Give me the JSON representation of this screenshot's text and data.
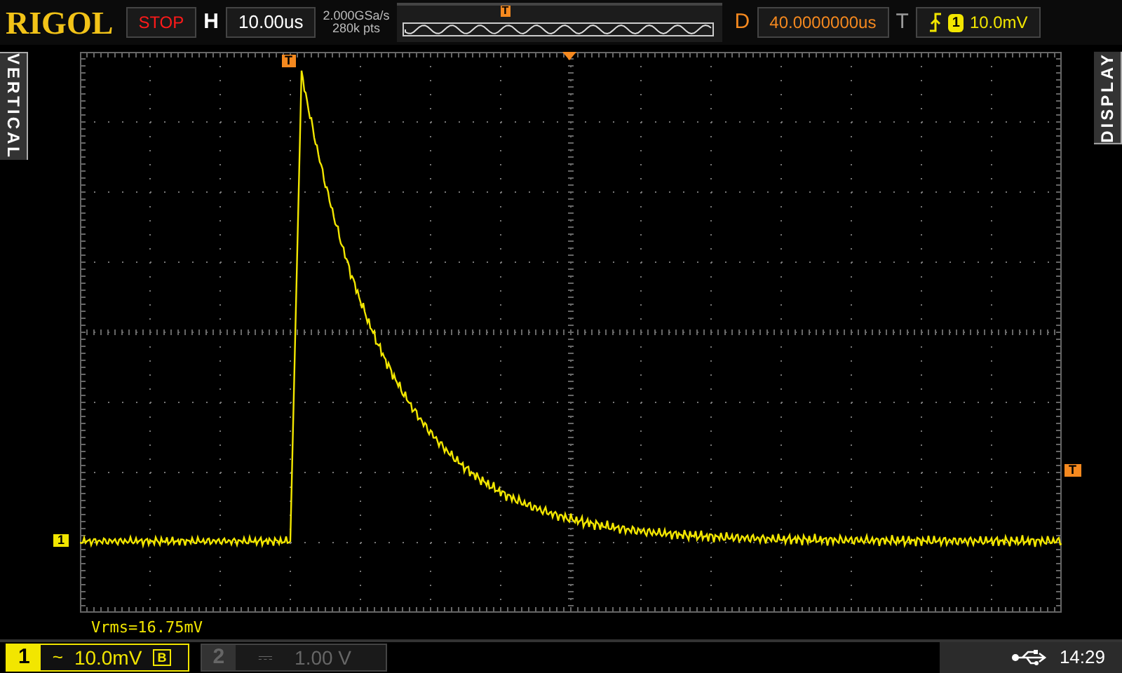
{
  "brand": "RIGOL",
  "run_state": "STOP",
  "horizontal": {
    "label": "H",
    "timebase": "10.00us"
  },
  "acquisition": {
    "sample_rate": "2.000GSa/s",
    "memory_depth": "280k pts"
  },
  "delay": {
    "label": "D",
    "value": "40.0000000us"
  },
  "trigger": {
    "label": "T",
    "channel": "1",
    "level": "10.0mV"
  },
  "side_tabs": [
    {
      "label": "VERTICAL",
      "kind": "left"
    },
    {
      "label": "DISPLAY",
      "kind": "right"
    }
  ],
  "markers": {
    "channel": "1",
    "memory_trigger_position": "T",
    "trigger_position": "T",
    "trigger_level": "T"
  },
  "measurement": "Vrms=16.75mV",
  "channels": [
    {
      "number": "1",
      "coupling": "~",
      "scale": "10.0mV",
      "badge": "B",
      "enabled": true
    },
    {
      "number": "2",
      "coupling": "⎓",
      "scale": "1.00 V",
      "enabled": false
    }
  ],
  "status": {
    "time": "14:29"
  }
}
